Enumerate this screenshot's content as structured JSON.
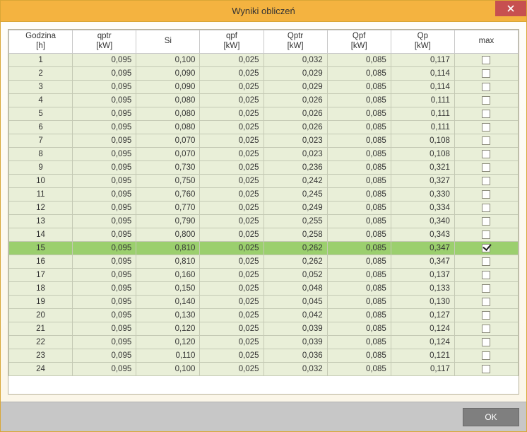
{
  "window": {
    "title": "Wyniki obliczeń"
  },
  "buttons": {
    "ok": "OK"
  },
  "table": {
    "columns": [
      {
        "line1": "Godzina",
        "line2": "[h]"
      },
      {
        "line1": "qptr",
        "line2": "[kW]"
      },
      {
        "line1": "Si",
        "line2": ""
      },
      {
        "line1": "qpf",
        "line2": "[kW]"
      },
      {
        "line1": "Qptr",
        "line2": "[kW]"
      },
      {
        "line1": "Qpf",
        "line2": "[kW]"
      },
      {
        "line1": "Qp",
        "line2": "[kW]"
      },
      {
        "line1": "max",
        "line2": ""
      }
    ],
    "rows": [
      {
        "h": "1",
        "qptr": "0,095",
        "si": "0,100",
        "qpf": "0,025",
        "Qptr": "0,032",
        "Qpf": "0,085",
        "Qp": "0,117",
        "max": false
      },
      {
        "h": "2",
        "qptr": "0,095",
        "si": "0,090",
        "qpf": "0,025",
        "Qptr": "0,029",
        "Qpf": "0,085",
        "Qp": "0,114",
        "max": false
      },
      {
        "h": "3",
        "qptr": "0,095",
        "si": "0,090",
        "qpf": "0,025",
        "Qptr": "0,029",
        "Qpf": "0,085",
        "Qp": "0,114",
        "max": false
      },
      {
        "h": "4",
        "qptr": "0,095",
        "si": "0,080",
        "qpf": "0,025",
        "Qptr": "0,026",
        "Qpf": "0,085",
        "Qp": "0,111",
        "max": false
      },
      {
        "h": "5",
        "qptr": "0,095",
        "si": "0,080",
        "qpf": "0,025",
        "Qptr": "0,026",
        "Qpf": "0,085",
        "Qp": "0,111",
        "max": false
      },
      {
        "h": "6",
        "qptr": "0,095",
        "si": "0,080",
        "qpf": "0,025",
        "Qptr": "0,026",
        "Qpf": "0,085",
        "Qp": "0,111",
        "max": false
      },
      {
        "h": "7",
        "qptr": "0,095",
        "si": "0,070",
        "qpf": "0,025",
        "Qptr": "0,023",
        "Qpf": "0,085",
        "Qp": "0,108",
        "max": false
      },
      {
        "h": "8",
        "qptr": "0,095",
        "si": "0,070",
        "qpf": "0,025",
        "Qptr": "0,023",
        "Qpf": "0,085",
        "Qp": "0,108",
        "max": false
      },
      {
        "h": "9",
        "qptr": "0,095",
        "si": "0,730",
        "qpf": "0,025",
        "Qptr": "0,236",
        "Qpf": "0,085",
        "Qp": "0,321",
        "max": false
      },
      {
        "h": "10",
        "qptr": "0,095",
        "si": "0,750",
        "qpf": "0,025",
        "Qptr": "0,242",
        "Qpf": "0,085",
        "Qp": "0,327",
        "max": false
      },
      {
        "h": "11",
        "qptr": "0,095",
        "si": "0,760",
        "qpf": "0,025",
        "Qptr": "0,245",
        "Qpf": "0,085",
        "Qp": "0,330",
        "max": false
      },
      {
        "h": "12",
        "qptr": "0,095",
        "si": "0,770",
        "qpf": "0,025",
        "Qptr": "0,249",
        "Qpf": "0,085",
        "Qp": "0,334",
        "max": false
      },
      {
        "h": "13",
        "qptr": "0,095",
        "si": "0,790",
        "qpf": "0,025",
        "Qptr": "0,255",
        "Qpf": "0,085",
        "Qp": "0,340",
        "max": false
      },
      {
        "h": "14",
        "qptr": "0,095",
        "si": "0,800",
        "qpf": "0,025",
        "Qptr": "0,258",
        "Qpf": "0,085",
        "Qp": "0,343",
        "max": false
      },
      {
        "h": "15",
        "qptr": "0,095",
        "si": "0,810",
        "qpf": "0,025",
        "Qptr": "0,262",
        "Qpf": "0,085",
        "Qp": "0,347",
        "max": true,
        "highlight": true
      },
      {
        "h": "16",
        "qptr": "0,095",
        "si": "0,810",
        "qpf": "0,025",
        "Qptr": "0,262",
        "Qpf": "0,085",
        "Qp": "0,347",
        "max": false
      },
      {
        "h": "17",
        "qptr": "0,095",
        "si": "0,160",
        "qpf": "0,025",
        "Qptr": "0,052",
        "Qpf": "0,085",
        "Qp": "0,137",
        "max": false
      },
      {
        "h": "18",
        "qptr": "0,095",
        "si": "0,150",
        "qpf": "0,025",
        "Qptr": "0,048",
        "Qpf": "0,085",
        "Qp": "0,133",
        "max": false
      },
      {
        "h": "19",
        "qptr": "0,095",
        "si": "0,140",
        "qpf": "0,025",
        "Qptr": "0,045",
        "Qpf": "0,085",
        "Qp": "0,130",
        "max": false
      },
      {
        "h": "20",
        "qptr": "0,095",
        "si": "0,130",
        "qpf": "0,025",
        "Qptr": "0,042",
        "Qpf": "0,085",
        "Qp": "0,127",
        "max": false
      },
      {
        "h": "21",
        "qptr": "0,095",
        "si": "0,120",
        "qpf": "0,025",
        "Qptr": "0,039",
        "Qpf": "0,085",
        "Qp": "0,124",
        "max": false
      },
      {
        "h": "22",
        "qptr": "0,095",
        "si": "0,120",
        "qpf": "0,025",
        "Qptr": "0,039",
        "Qpf": "0,085",
        "Qp": "0,124",
        "max": false
      },
      {
        "h": "23",
        "qptr": "0,095",
        "si": "0,110",
        "qpf": "0,025",
        "Qptr": "0,036",
        "Qpf": "0,085",
        "Qp": "0,121",
        "max": false
      },
      {
        "h": "24",
        "qptr": "0,095",
        "si": "0,100",
        "qpf": "0,025",
        "Qptr": "0,032",
        "Qpf": "0,085",
        "Qp": "0,117",
        "max": false
      }
    ]
  }
}
